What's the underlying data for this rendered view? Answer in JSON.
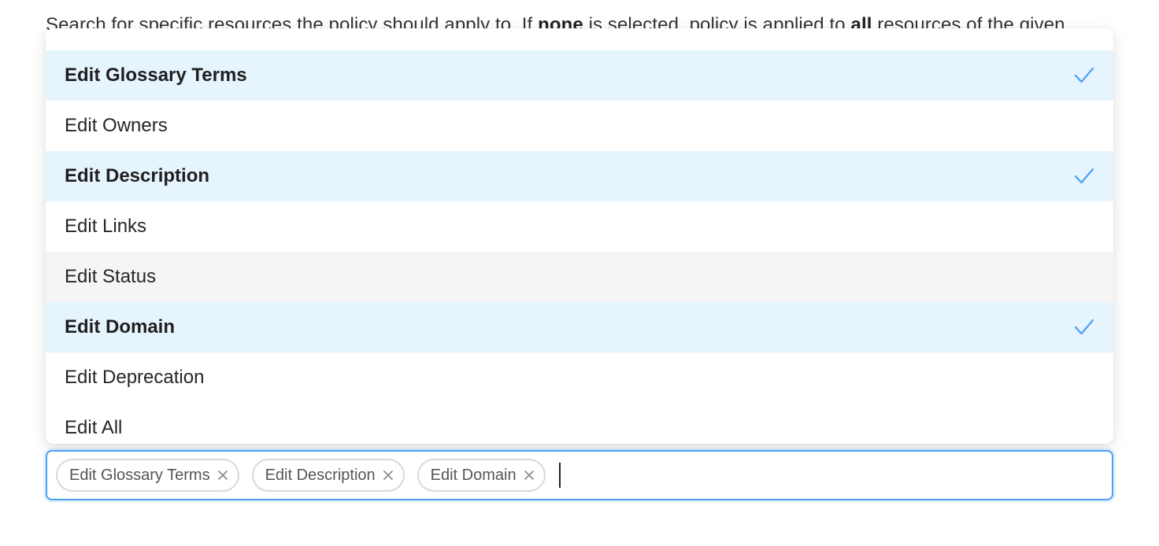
{
  "background": {
    "text_pre": "Search for specific resources the policy should apply to. If ",
    "text_none": "none",
    "text_mid": " is selected, policy is applied to ",
    "text_all": "all",
    "text_post": " resources of the given"
  },
  "dropdown": {
    "options": [
      {
        "label": "Edit Glossary Terms",
        "selected": true
      },
      {
        "label": "Edit Owners",
        "selected": false
      },
      {
        "label": "Edit Description",
        "selected": true
      },
      {
        "label": "Edit Links",
        "selected": false
      },
      {
        "label": "Edit Status",
        "selected": false,
        "hovered": true
      },
      {
        "label": "Edit Domain",
        "selected": true
      },
      {
        "label": "Edit Deprecation",
        "selected": false
      },
      {
        "label": "Edit All",
        "selected": false
      }
    ]
  },
  "select": {
    "tags": [
      {
        "label": "Edit Glossary Terms"
      },
      {
        "label": "Edit Description"
      },
      {
        "label": "Edit Domain"
      }
    ]
  },
  "colors": {
    "accent": "#4a9ff5",
    "selected_bg": "#e6f4fe",
    "hover_bg": "#f5f5f5"
  },
  "icons": {
    "check": "check-icon",
    "tag_remove": "close-icon"
  }
}
